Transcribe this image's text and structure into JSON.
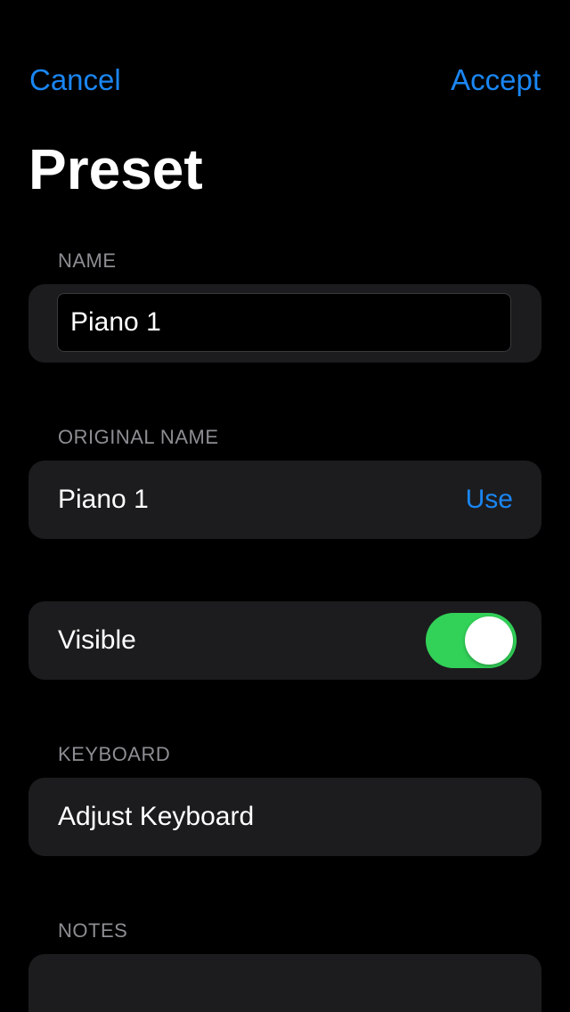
{
  "nav": {
    "cancel_label": "Cancel",
    "accept_label": "Accept"
  },
  "title": "Preset",
  "name_section": {
    "header": "NAME",
    "field_value": "Piano 1"
  },
  "original_name_section": {
    "header": "ORIGINAL NAME",
    "value": "Piano 1",
    "use_label": "Use"
  },
  "visible_section": {
    "label": "Visible",
    "toggle_on": true,
    "toggle_color": "#32d158"
  },
  "keyboard_section": {
    "header": "KEYBOARD",
    "adjust_label": "Adjust Keyboard"
  },
  "notes_section": {
    "header": "NOTES",
    "text": ""
  },
  "colors": {
    "accent": "#1a86f3",
    "background": "#000000",
    "group_background": "#1c1c1e",
    "secondary_text": "#8d8d93"
  }
}
